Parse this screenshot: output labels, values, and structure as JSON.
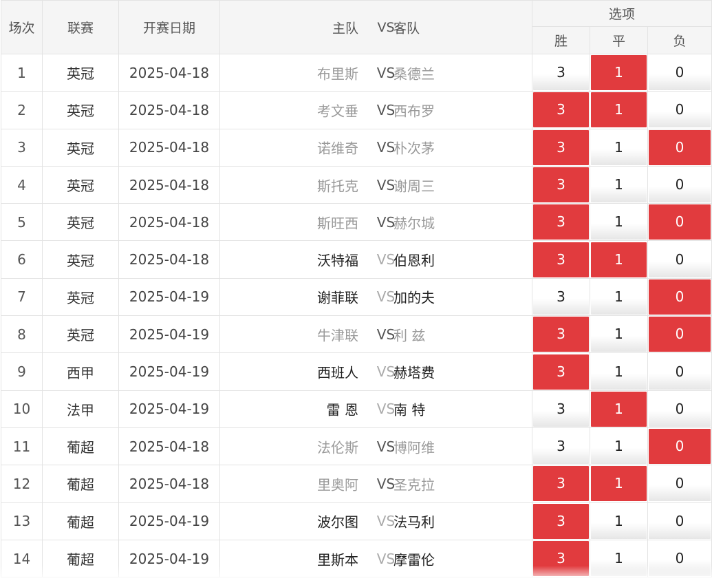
{
  "header": {
    "idx": "场次",
    "league": "联赛",
    "date": "开赛日期",
    "home": "主队",
    "vs": "VS",
    "away": "客队",
    "options": "选项",
    "win": "胜",
    "draw": "平",
    "lose": "负"
  },
  "colors": {
    "selected": "#e13b3e",
    "header_bg": "#f5f5f5"
  },
  "rows": [
    {
      "idx": "1",
      "league": "英冠",
      "date": "2025-04-18",
      "home": "布里斯",
      "away": "桑德兰",
      "started": true,
      "win": "3",
      "draw": "1",
      "lose": "0",
      "sel_win": false,
      "sel_draw": true,
      "sel_lose": false
    },
    {
      "idx": "2",
      "league": "英冠",
      "date": "2025-04-18",
      "home": "考文垂",
      "away": "西布罗",
      "started": true,
      "win": "3",
      "draw": "1",
      "lose": "0",
      "sel_win": true,
      "sel_draw": true,
      "sel_lose": false
    },
    {
      "idx": "3",
      "league": "英冠",
      "date": "2025-04-18",
      "home": "诺维奇",
      "away": "朴次茅",
      "started": true,
      "win": "3",
      "draw": "1",
      "lose": "0",
      "sel_win": true,
      "sel_draw": false,
      "sel_lose": true
    },
    {
      "idx": "4",
      "league": "英冠",
      "date": "2025-04-18",
      "home": "斯托克",
      "away": "谢周三",
      "started": true,
      "win": "3",
      "draw": "1",
      "lose": "0",
      "sel_win": true,
      "sel_draw": false,
      "sel_lose": false
    },
    {
      "idx": "5",
      "league": "英冠",
      "date": "2025-04-18",
      "home": "斯旺西",
      "away": "赫尔城",
      "started": true,
      "win": "3",
      "draw": "1",
      "lose": "0",
      "sel_win": true,
      "sel_draw": false,
      "sel_lose": true
    },
    {
      "idx": "6",
      "league": "英冠",
      "date": "2025-04-18",
      "home": "沃特福",
      "away": "伯恩利",
      "started": false,
      "win": "3",
      "draw": "1",
      "lose": "0",
      "sel_win": true,
      "sel_draw": true,
      "sel_lose": false
    },
    {
      "idx": "7",
      "league": "英冠",
      "date": "2025-04-19",
      "home": "谢菲联",
      "away": "加的夫",
      "started": false,
      "win": "3",
      "draw": "1",
      "lose": "0",
      "sel_win": false,
      "sel_draw": false,
      "sel_lose": true
    },
    {
      "idx": "8",
      "league": "英冠",
      "date": "2025-04-19",
      "home": "牛津联",
      "away": "利 兹",
      "started": true,
      "win": "3",
      "draw": "1",
      "lose": "0",
      "sel_win": true,
      "sel_draw": false,
      "sel_lose": true
    },
    {
      "idx": "9",
      "league": "西甲",
      "date": "2025-04-19",
      "home": "西班人",
      "away": "赫塔费",
      "started": false,
      "win": "3",
      "draw": "1",
      "lose": "0",
      "sel_win": true,
      "sel_draw": false,
      "sel_lose": false
    },
    {
      "idx": "10",
      "league": "法甲",
      "date": "2025-04-19",
      "home": "雷 恩",
      "away": "南 特",
      "started": false,
      "win": "3",
      "draw": "1",
      "lose": "0",
      "sel_win": false,
      "sel_draw": true,
      "sel_lose": false
    },
    {
      "idx": "11",
      "league": "葡超",
      "date": "2025-04-18",
      "home": "法伦斯",
      "away": "博阿维",
      "started": true,
      "win": "3",
      "draw": "1",
      "lose": "0",
      "sel_win": false,
      "sel_draw": false,
      "sel_lose": true
    },
    {
      "idx": "12",
      "league": "葡超",
      "date": "2025-04-18",
      "home": "里奥阿",
      "away": "圣克拉",
      "started": true,
      "win": "3",
      "draw": "1",
      "lose": "0",
      "sel_win": true,
      "sel_draw": true,
      "sel_lose": false
    },
    {
      "idx": "13",
      "league": "葡超",
      "date": "2025-04-19",
      "home": "波尔图",
      "away": "法马利",
      "started": false,
      "win": "3",
      "draw": "1",
      "lose": "0",
      "sel_win": true,
      "sel_draw": false,
      "sel_lose": false
    },
    {
      "idx": "14",
      "league": "葡超",
      "date": "2025-04-19",
      "home": "里斯本",
      "away": "摩雷伦",
      "started": false,
      "win": "3",
      "draw": "1",
      "lose": "0",
      "sel_win": true,
      "sel_draw": false,
      "sel_lose": false
    }
  ]
}
